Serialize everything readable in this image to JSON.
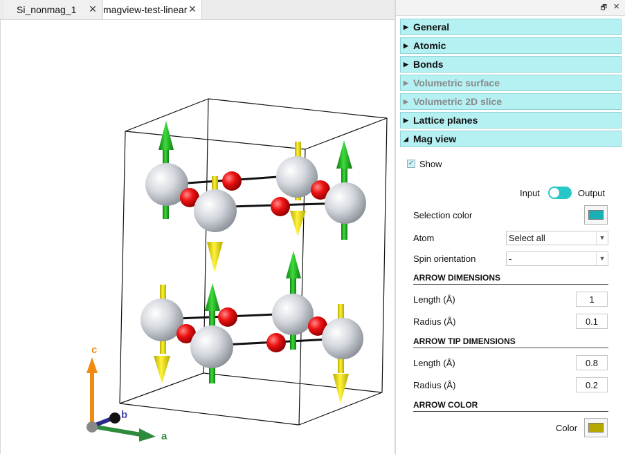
{
  "tabs": [
    {
      "label": "Si_nonmag_1"
    },
    {
      "label": "magview-test-linear"
    }
  ],
  "panel": {
    "sections": [
      {
        "label": "General",
        "enabled": true,
        "expanded": false
      },
      {
        "label": "Atomic",
        "enabled": true,
        "expanded": false
      },
      {
        "label": "Bonds",
        "enabled": true,
        "expanded": false
      },
      {
        "label": "Volumetric surface",
        "enabled": false,
        "expanded": false
      },
      {
        "label": "Volumetric 2D slice",
        "enabled": false,
        "expanded": false
      },
      {
        "label": "Lattice planes",
        "enabled": true,
        "expanded": false
      },
      {
        "label": "Mag view",
        "enabled": true,
        "expanded": true
      }
    ],
    "magview": {
      "show_label": "Show",
      "show_checked": true,
      "toggle_left": "Input",
      "toggle_right": "Output",
      "selection_color_label": "Selection color",
      "selection_color": "#1ab0b8",
      "atom_label": "Atom",
      "atom_value": "Select all",
      "spin_label": "Spin orientation",
      "spin_value": "-",
      "arrow_dim_header": "ARROW DIMENSIONS",
      "length_label": "Length (Å)",
      "length_value": "1",
      "radius_label": "Radius (Å)",
      "radius_value": "0.1",
      "tip_header": "ARROW TIP DIMENSIONS",
      "tip_length_label": "Length (Å)",
      "tip_length_value": "0.8",
      "tip_radius_label": "Radius (Å)",
      "tip_radius_value": "0.2",
      "color_header": "ARROW COLOR",
      "color_label": "Color",
      "arrow_color": "#b5a800"
    }
  },
  "axes": {
    "a": "a",
    "b": "b",
    "c": "c"
  },
  "colors": {
    "section_bg": "#b5f0f2",
    "atom_gray": "#d0d4da",
    "atom_red": "#ee1111",
    "arrow_green": "#22bb22",
    "arrow_yellow": "#f2e600",
    "axis_a": "#2e8b3e",
    "axis_b": "#2a2a8a",
    "axis_c": "#f08a10"
  }
}
